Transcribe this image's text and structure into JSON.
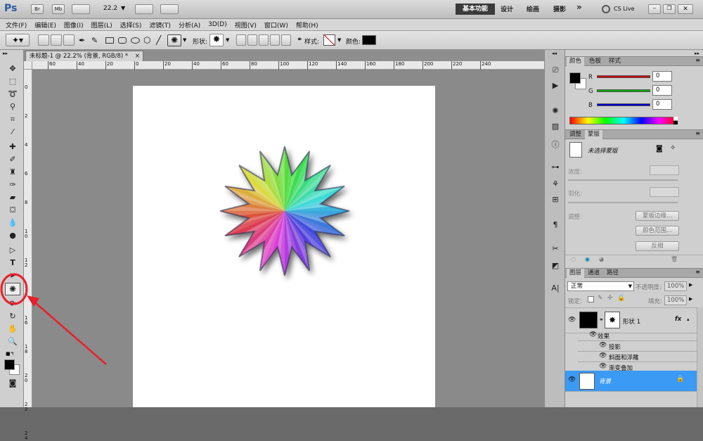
{
  "app": {
    "logo": "Ps",
    "zoom_value": "22.2",
    "workspaces": [
      "基本功能",
      "设计",
      "绘画",
      "摄影"
    ],
    "more": "»",
    "cslive": "CS Live"
  },
  "menu": [
    "文件(F)",
    "编辑(E)",
    "图像(I)",
    "图层(L)",
    "选择(S)",
    "滤镜(T)",
    "分析(A)",
    "3D(D)",
    "视图(V)",
    "窗口(W)",
    "帮助(H)"
  ],
  "options": {
    "shape_label": "形状:",
    "style_label": "样式:",
    "color_label": "颜色:",
    "color_value": "#000000"
  },
  "document": {
    "tab_title": "未标题-1 @ 22.2% (背景, RGB/8) *",
    "close": "×"
  },
  "ruler": {
    "h_ticks": [
      "60",
      "40",
      "20",
      "0",
      "20",
      "40",
      "60",
      "80",
      "100",
      "120",
      "140",
      "160",
      "180",
      "200",
      "220",
      "240"
    ],
    "v_ticks": [
      "0",
      "2",
      "4",
      "6",
      "8",
      "10",
      "12",
      "14",
      "16",
      "18",
      "20",
      "22",
      "24"
    ]
  },
  "color_panel": {
    "tabs": [
      "颜色",
      "色板",
      "样式"
    ],
    "channels": [
      {
        "label": "R",
        "value": "0",
        "color": "#cc0000"
      },
      {
        "label": "G",
        "value": "0",
        "color": "#00aa00"
      },
      {
        "label": "B",
        "value": "0",
        "color": "#0000cc"
      }
    ],
    "foreground": "#000000",
    "background": "#ffffff"
  },
  "mask_panel": {
    "tabs": [
      "调整",
      "蒙版"
    ],
    "title": "未选择蒙版",
    "density_label": "浓度:",
    "feather_label": "羽化:",
    "refine_label": "调整:",
    "buttons": [
      "蒙版边缘...",
      "颜色范围...",
      "反相"
    ]
  },
  "layers_panel": {
    "tabs": [
      "图层",
      "通道",
      "路径"
    ],
    "blend_mode": "正常",
    "opacity_label": "不透明度:",
    "opacity_value": "100%",
    "lock_label": "锁定:",
    "fill_label": "填充:",
    "fill_value": "100%",
    "fx": "fx",
    "layers": [
      {
        "name": "形状 1",
        "effects_label": "效果",
        "effects": [
          "投影",
          "斜面和浮雕",
          "渐变叠加"
        ]
      },
      {
        "name": "背景",
        "selected": true
      }
    ]
  },
  "annotation": {
    "color": "#e8202a"
  }
}
